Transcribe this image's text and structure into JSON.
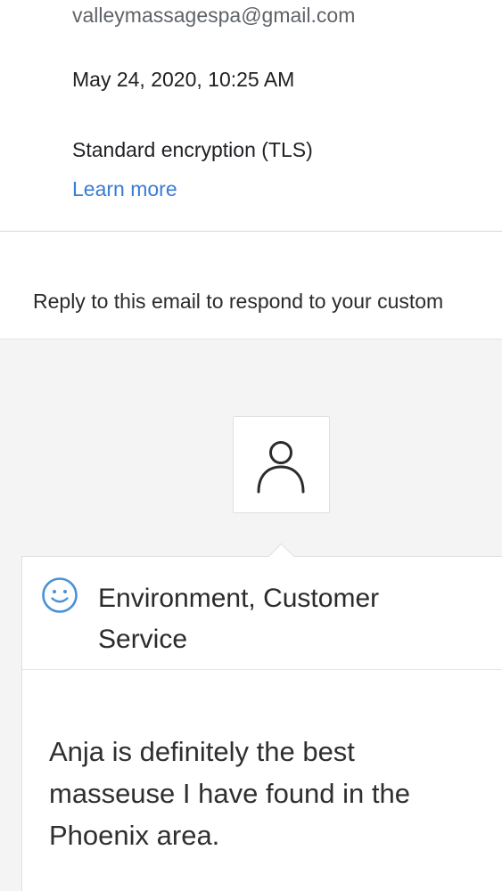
{
  "email_details": {
    "sender": "valleymassagespa@gmail.com",
    "date": "May 24, 2020, 10:25 AM",
    "security": "Standard encryption (TLS)",
    "learn_more": "Learn more"
  },
  "banner": {
    "text": "Reply to this email to respond to your custom"
  },
  "review": {
    "avatar_icon": "person-icon",
    "sentiment_icon": "smiley-icon",
    "categories": "Environment, Customer Service",
    "text": "Anja is definitely the best masseuse I have found in the Phoenix area."
  },
  "colors": {
    "link": "#3a7bd5",
    "background_grey": "#f4f4f4",
    "smiley_accent": "#4a90d9"
  }
}
